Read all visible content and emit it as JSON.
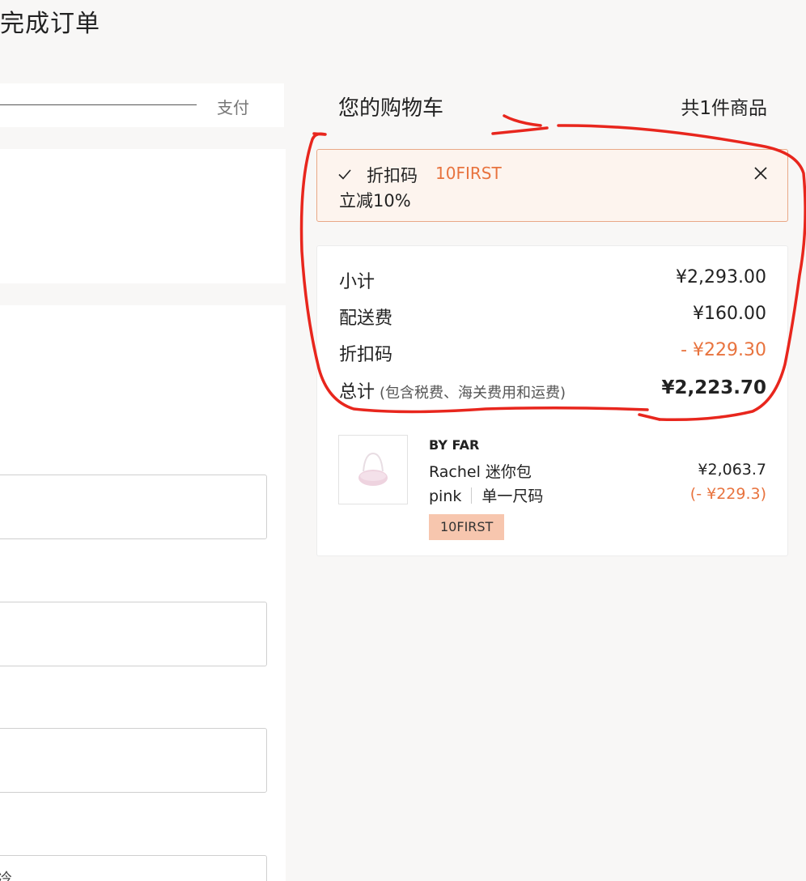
{
  "page_title": "完成订单",
  "checkout_steps": {
    "current_step_label": "支付"
  },
  "cart": {
    "title": "您的购物车",
    "item_count": "共1件商品"
  },
  "coupon": {
    "label": "折扣码",
    "code": "10FIRST",
    "description": "立减10%"
  },
  "summary": {
    "subtotal_label": "小计",
    "subtotal_value": "¥2,293.00",
    "shipping_label": "配送费",
    "shipping_value": "¥160.00",
    "discount_label": "折扣码",
    "discount_value": "- ¥229.30",
    "total_label": "总计",
    "total_note": "(包含税费、海关费用和运费)",
    "total_value": "¥2,223.70"
  },
  "product": {
    "brand": "BY FAR",
    "name": "Rachel 迷你包",
    "color": "pink",
    "size": "单一尺码",
    "price": "¥2,063.7",
    "discount": "(- ¥229.3)",
    "promo_tag": "10FIRST"
  },
  "left_form": {
    "partial_field_text": "冷"
  },
  "colors": {
    "accent": "#e8733e",
    "annotation": "#e8261d",
    "promo_tag_bg": "#f7c6ae",
    "background": "#f8f7f6"
  },
  "icons": [
    "check-icon",
    "close-icon",
    "product-image"
  ]
}
